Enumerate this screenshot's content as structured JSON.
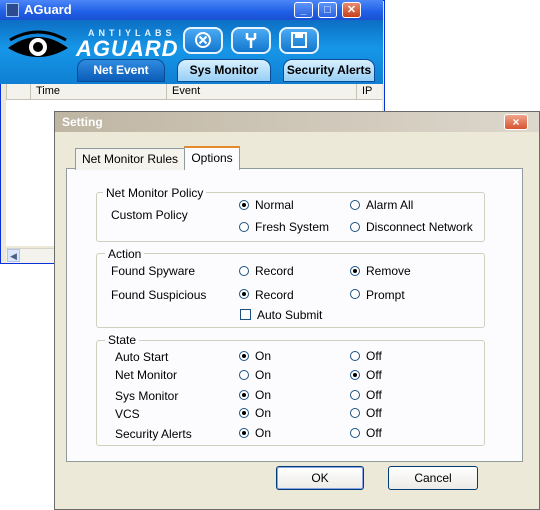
{
  "aguard": {
    "title": "AGuard",
    "logo_small": "ANTIYLABS",
    "logo_big": "AGUARD",
    "tabs": [
      "Net Event",
      "Sys Monitor",
      "Security Alerts"
    ],
    "columns": [
      "Time",
      "Event",
      "IP"
    ],
    "toolbar_icons": [
      "stop-icon",
      "wrench-icon",
      "save-icon"
    ]
  },
  "dialog": {
    "title": "Setting",
    "close_label": "×",
    "tabs": [
      "Net Monitor Rules",
      "Options"
    ],
    "net_monitor_policy": {
      "title": "Net Monitor Policy",
      "custom_policy_label": "Custom Policy",
      "options": [
        "Normal",
        "Alarm All",
        "Fresh System",
        "Disconnect Network"
      ],
      "selected": "Normal"
    },
    "action": {
      "title": "Action",
      "found_spyware_label": "Found Spyware",
      "found_suspicious_label": "Found Suspicious",
      "record_label": "Record",
      "remove_label": "Remove",
      "prompt_label": "Prompt",
      "spyware_selected": "Remove",
      "suspicious_selected": "Record",
      "auto_submit_label": "Auto Submit",
      "auto_submit_checked": false
    },
    "state": {
      "title": "State",
      "on_label": "On",
      "off_label": "Off",
      "rows": [
        {
          "label": "Auto Start",
          "value": "On"
        },
        {
          "label": "Net Monitor",
          "value": "Off"
        },
        {
          "label": "Sys Monitor",
          "value": "On"
        },
        {
          "label": "VCS",
          "value": "On"
        },
        {
          "label": "Security Alerts",
          "value": "On"
        }
      ]
    },
    "ok_label": "OK",
    "cancel_label": "Cancel"
  }
}
